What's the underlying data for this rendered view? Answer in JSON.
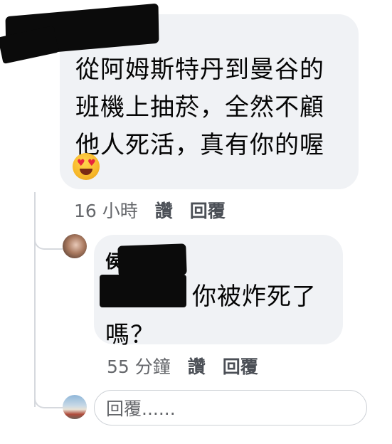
{
  "comment": {
    "body": "從阿姆斯特丹到曼谷的\n班機上抽菸，全然不顧\n他人死活，真有你的喔",
    "emoji": "heart-eyes-emoji",
    "time": "16 小時",
    "like_label": "讚",
    "reply_label": "回覆"
  },
  "reply": {
    "author_visible": "侯",
    "body_line1": "你被炸死了",
    "body_line2": "嗎？",
    "time": "55 分鐘",
    "like_label": "讚",
    "reply_label": "回覆"
  },
  "composer": {
    "placeholder": "回覆......"
  }
}
